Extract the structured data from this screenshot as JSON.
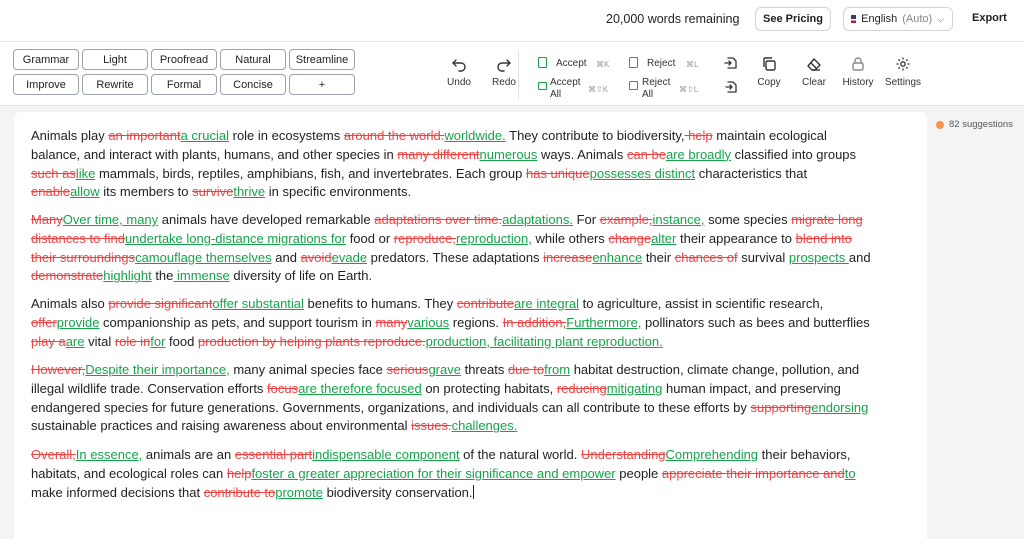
{
  "header": {
    "words_remaining": "20,000 words remaining",
    "see_pricing": "See Pricing",
    "language": "English",
    "language_mode": "(Auto)",
    "export": "Export"
  },
  "styles": {
    "row1": [
      "Grammar",
      "Light",
      "Proofread",
      "Natural",
      "Streamline"
    ],
    "row2": [
      "Improve",
      "Rewrite",
      "Formal",
      "Concise",
      "+"
    ]
  },
  "tools": {
    "undo": "Undo",
    "redo": "Redo",
    "accept": "Accept",
    "accept_kbd": "⌘K",
    "accept_all_1": "Accept",
    "accept_all_2": "All",
    "accept_all_kbd": "⌘⇧K",
    "reject": "Reject",
    "reject_kbd": "⌘L",
    "reject_all_1": "Reject",
    "reject_all_2": "All",
    "reject_all_kbd": "⌘⇧L",
    "copy": "Copy",
    "clear": "Clear",
    "history": "History",
    "settings": "Settings"
  },
  "suggestions_count": "82 suggestions",
  "paragraphs": [
    [
      [
        "t",
        "Animals play "
      ],
      [
        "d",
        "an important"
      ],
      [
        "i",
        "a crucial"
      ],
      [
        "t",
        " role in ecosystems "
      ],
      [
        "d",
        "around the world."
      ],
      [
        "i",
        "worldwide."
      ],
      [
        "t",
        " They contribute to biodiversity,"
      ],
      [
        "d",
        " help"
      ],
      [
        "t",
        " maintain ecological balance, and interact with plants, humans, and other species in "
      ],
      [
        "d",
        "many different"
      ],
      [
        "i",
        "numerous"
      ],
      [
        "t",
        " ways. Animals "
      ],
      [
        "d",
        "can be"
      ],
      [
        "i",
        "are broadly"
      ],
      [
        "t",
        " classified into groups "
      ],
      [
        "d",
        "such as"
      ],
      [
        "i",
        "like"
      ],
      [
        "t",
        " mammals, birds, reptiles, amphibians, fish, and invertebrates. Each group "
      ],
      [
        "d",
        "has unique"
      ],
      [
        "i",
        "possesses distinct"
      ],
      [
        "t",
        " characteristics that "
      ],
      [
        "d",
        "enable"
      ],
      [
        "i",
        "allow"
      ],
      [
        "t",
        " its members to "
      ],
      [
        "d",
        "survive"
      ],
      [
        "i",
        "thrive"
      ],
      [
        "t",
        " in specific environments."
      ]
    ],
    [
      [
        "d",
        "Many"
      ],
      [
        "i",
        "Over time, many"
      ],
      [
        "t",
        " animals have developed remarkable "
      ],
      [
        "d",
        "adaptations over time."
      ],
      [
        "i",
        "adaptations."
      ],
      [
        "t",
        " For "
      ],
      [
        "d",
        "example,"
      ],
      [
        "i",
        "instance,"
      ],
      [
        "t",
        " some species "
      ],
      [
        "d",
        "migrate long distances to find"
      ],
      [
        "i",
        "undertake long-distance migrations for"
      ],
      [
        "t",
        " food or "
      ],
      [
        "d",
        "reproduce,"
      ],
      [
        "i",
        "reproduction,"
      ],
      [
        "t",
        " while others "
      ],
      [
        "d",
        "change"
      ],
      [
        "i",
        "alter"
      ],
      [
        "t",
        " their appearance to "
      ],
      [
        "d",
        "blend into their surroundings"
      ],
      [
        "i",
        "camouflage themselves"
      ],
      [
        "t",
        " and "
      ],
      [
        "d",
        "avoid"
      ],
      [
        "i",
        "evade"
      ],
      [
        "t",
        " predators. These adaptations "
      ],
      [
        "d",
        "increase"
      ],
      [
        "i",
        "enhance"
      ],
      [
        "t",
        " their "
      ],
      [
        "d",
        "chances of"
      ],
      [
        "t",
        " survival "
      ],
      [
        "i",
        "prospects "
      ],
      [
        "t",
        "and "
      ],
      [
        "d",
        "demonstrate"
      ],
      [
        "i",
        "highlight"
      ],
      [
        "t",
        " the"
      ],
      [
        "i",
        " immense"
      ],
      [
        "t",
        " diversity of life on Earth."
      ]
    ],
    [
      [
        "t",
        "Animals also "
      ],
      [
        "d",
        "provide significant"
      ],
      [
        "i",
        "offer substantial"
      ],
      [
        "t",
        " benefits to humans. They "
      ],
      [
        "d",
        "contribute"
      ],
      [
        "i",
        "are integral"
      ],
      [
        "t",
        " to agriculture, assist in scientific research, "
      ],
      [
        "d",
        "offer"
      ],
      [
        "i",
        "provide"
      ],
      [
        "t",
        " companionship as pets, and support tourism in "
      ],
      [
        "d",
        "many"
      ],
      [
        "i",
        "various"
      ],
      [
        "t",
        " regions. "
      ],
      [
        "d",
        "In addition,"
      ],
      [
        "i",
        "Furthermore,"
      ],
      [
        "t",
        " pollinators such as bees and butterflies "
      ],
      [
        "d",
        "play a"
      ],
      [
        "i",
        "are"
      ],
      [
        "t",
        " vital "
      ],
      [
        "d",
        "role in"
      ],
      [
        "i",
        "for"
      ],
      [
        "t",
        " food "
      ],
      [
        "d",
        "production by helping plants reproduce."
      ],
      [
        "i",
        "production, facilitating plant reproduction."
      ]
    ],
    [
      [
        "d",
        "However,"
      ],
      [
        "i",
        "Despite their importance,"
      ],
      [
        "t",
        " many animal species face "
      ],
      [
        "d",
        "serious"
      ],
      [
        "i",
        "grave"
      ],
      [
        "t",
        " threats "
      ],
      [
        "d",
        "due to"
      ],
      [
        "i",
        "from"
      ],
      [
        "t",
        " habitat destruction, climate change, pollution, and illegal wildlife trade. Conservation efforts "
      ],
      [
        "d",
        "focus"
      ],
      [
        "i",
        "are therefore focused"
      ],
      [
        "t",
        " on protecting habitats, "
      ],
      [
        "d",
        "reducing"
      ],
      [
        "i",
        "mitigating"
      ],
      [
        "t",
        " human impact, and preserving endangered species for future generations. Governments, organizations, and individuals can all contribute to these efforts by "
      ],
      [
        "d",
        "supporting"
      ],
      [
        "i",
        "endorsing"
      ],
      [
        "t",
        " sustainable practices and raising awareness about environmental "
      ],
      [
        "d",
        "issues."
      ],
      [
        "i",
        "challenges."
      ]
    ],
    [
      [
        "d",
        "Overall,"
      ],
      [
        "i",
        "In essence,"
      ],
      [
        "t",
        " animals are an "
      ],
      [
        "d",
        "essential part"
      ],
      [
        "i",
        "indispensable component"
      ],
      [
        "t",
        " of the natural world. "
      ],
      [
        "d",
        "Understanding"
      ],
      [
        "i",
        "Comprehending"
      ],
      [
        "t",
        " their behaviors, habitats, and ecological roles can "
      ],
      [
        "d",
        "help"
      ],
      [
        "i",
        "foster a greater appreciation for their significance and empower"
      ],
      [
        "t",
        " people "
      ],
      [
        "d",
        "appreciate their importance and"
      ],
      [
        "i",
        "to"
      ],
      [
        "t",
        " make informed decisions that "
      ],
      [
        "d",
        "contribute to"
      ],
      [
        "i",
        "promote"
      ],
      [
        "t",
        " biodiversity conservation."
      ]
    ]
  ]
}
